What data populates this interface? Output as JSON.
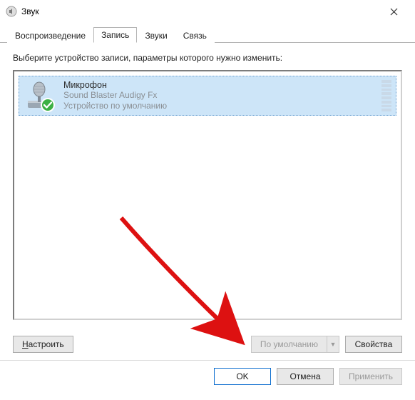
{
  "window": {
    "title": "Звук"
  },
  "tabs": [
    {
      "label": "Воспроизведение",
      "active": false
    },
    {
      "label": "Запись",
      "active": true
    },
    {
      "label": "Звуки",
      "active": false
    },
    {
      "label": "Связь",
      "active": false
    }
  ],
  "instruction": "Выберите устройство записи, параметры которого нужно изменить:",
  "devices": [
    {
      "name": "Микрофон",
      "subtitle": "Sound Blaster Audigy Fx",
      "status": "Устройство по умолчанию",
      "default": true,
      "selected": true
    }
  ],
  "buttons": {
    "configure": "Настроить",
    "set_default": "По умолчанию",
    "properties": "Свойства",
    "ok": "OK",
    "cancel": "Отмена",
    "apply": "Применить"
  },
  "states": {
    "set_default_enabled": false,
    "apply_enabled": false
  }
}
